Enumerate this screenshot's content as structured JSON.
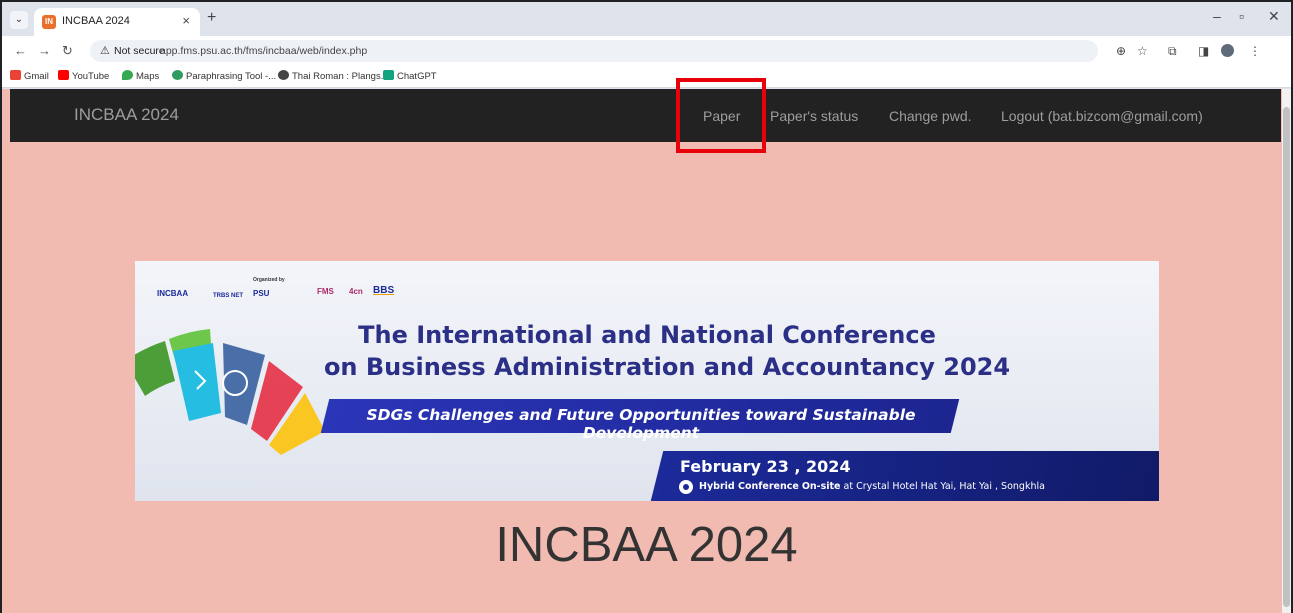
{
  "browser": {
    "tab_title": "INCBAA 2024",
    "tab_favicon": "IN",
    "tab_close": "×",
    "new_tab": "+",
    "address": {
      "security_label": "Not secure",
      "url": "app.fms.psu.ac.th/fms/incbaa/web/index.php"
    },
    "bookmarks": [
      {
        "label": "Gmail",
        "color": "#ea4335"
      },
      {
        "label": "YouTube",
        "color": "#ff0000"
      },
      {
        "label": "Maps",
        "color": "#34a853"
      },
      {
        "label": "Paraphrasing Tool -...",
        "color": "#2e9c5e"
      },
      {
        "label": "Thai Roman : Plangs...",
        "color": "#444444"
      },
      {
        "label": "ChatGPT",
        "color": "#10a37f"
      }
    ]
  },
  "navbar": {
    "brand": "INCBAA 2024",
    "links": [
      "Paper",
      "Paper's status",
      "Change pwd.",
      "Logout (bat.bizcom@gmail.com)"
    ]
  },
  "banner": {
    "logos": [
      "INCBAA",
      "TRBS NET",
      "PSU",
      "FMS",
      "4cn",
      "BBS"
    ],
    "organized_by": "Organized by",
    "title_line1": "The International and National Conference",
    "title_line2": "on Business Administration and Accountancy 2024",
    "slogan": "SDGs Challenges and Future Opportunities toward Sustainable Development",
    "date": "February 23 , 2024",
    "conference_type": "Hybrid Conference",
    "onsite_label": "On-site",
    "venue": "at  Crystal Hotel Hat Yai, Hat Yai , Songkhla"
  },
  "page": {
    "heading": "INCBAA 2024"
  },
  "colors": {
    "page_background": "#f1bbb1",
    "navbar_background": "#222222",
    "highlight": "#e8000b",
    "banner_blue": "#2b2f86"
  }
}
